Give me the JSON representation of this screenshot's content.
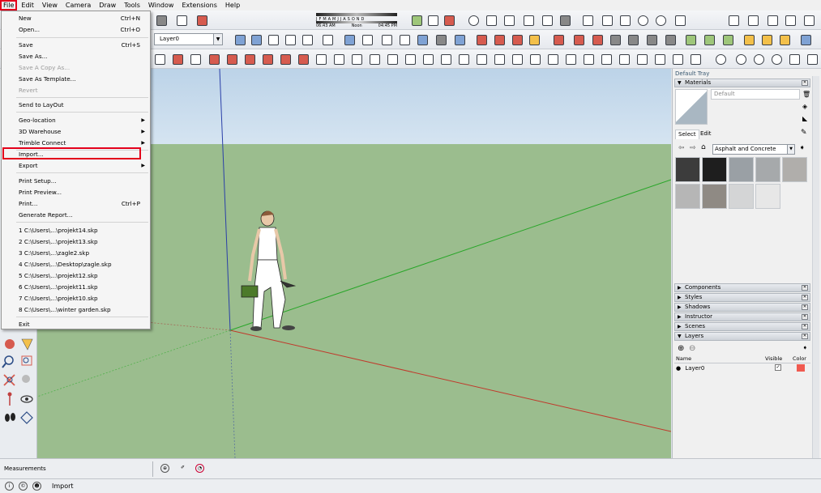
{
  "menubar": {
    "items": [
      "File",
      "Edit",
      "View",
      "Camera",
      "Draw",
      "Tools",
      "Window",
      "Extensions",
      "Help"
    ],
    "active": "File"
  },
  "shadows": {
    "months": "J F M A M J J A S O N D",
    "time_start": "06:43 AM",
    "time_mid": "Noon",
    "time_end": "04:45 PM"
  },
  "layer_select": {
    "value": "Layer0"
  },
  "file_menu": {
    "items": [
      {
        "label": "New",
        "shortcut": "Ctrl+N"
      },
      {
        "label": "Open...",
        "shortcut": "Ctrl+O"
      },
      {
        "label": "Save",
        "shortcut": "Ctrl+S"
      },
      {
        "label": "Save As...",
        "shortcut": ""
      },
      {
        "label": "Save A Copy As...",
        "shortcut": ""
      },
      {
        "label": "Save As Template...",
        "shortcut": ""
      },
      {
        "label": "Revert",
        "shortcut": ""
      },
      {
        "label": "Send to LayOut",
        "shortcut": ""
      },
      {
        "label": "Geo-location",
        "shortcut": ""
      },
      {
        "label": "3D Warehouse",
        "shortcut": ""
      },
      {
        "label": "Trimble Connect",
        "shortcut": ""
      },
      {
        "label": "Import...",
        "shortcut": ""
      },
      {
        "label": "Export",
        "shortcut": ""
      },
      {
        "label": "Print Setup...",
        "shortcut": ""
      },
      {
        "label": "Print Preview...",
        "shortcut": ""
      },
      {
        "label": "Print...",
        "shortcut": "Ctrl+P"
      },
      {
        "label": "Generate Report...",
        "shortcut": ""
      },
      {
        "label": "1 C:\\Users\\...\\projekt14.skp",
        "shortcut": ""
      },
      {
        "label": "2 C:\\Users\\...\\projekt13.skp",
        "shortcut": ""
      },
      {
        "label": "3 C:\\Users\\...\\zagle2.skp",
        "shortcut": ""
      },
      {
        "label": "4 C:\\Users\\...\\Desktop\\zagle.skp",
        "shortcut": ""
      },
      {
        "label": "5 C:\\Users\\...\\projekt12.skp",
        "shortcut": ""
      },
      {
        "label": "6 C:\\Users\\...\\projekt11.skp",
        "shortcut": ""
      },
      {
        "label": "7 C:\\Users\\...\\projekt10.skp",
        "shortcut": ""
      },
      {
        "label": "8 C:\\Users\\...\\winter garden.skp",
        "shortcut": ""
      },
      {
        "label": "Exit",
        "shortcut": ""
      }
    ]
  },
  "tray": {
    "title": "Default Tray",
    "materials": {
      "title": "Materials",
      "name_value": "Default",
      "tab_select": "Select",
      "tab_edit": "Edit",
      "category": "Asphalt and Concrete",
      "swatch_colors": [
        "#3c3c3c",
        "#1e1e1e",
        "#9aa0a5",
        "#a6a9ab",
        "#b0aeab",
        "#b6b6b6",
        "#8f8a84",
        "#d4d5d6",
        "#e7e7e7"
      ]
    },
    "panels": [
      "Components",
      "Styles",
      "Shadows",
      "Instructor",
      "Scenes"
    ],
    "layers": {
      "title": "Layers",
      "col_name": "Name",
      "col_visible": "Visible",
      "col_color": "Color",
      "rows": [
        {
          "name": "Layer0",
          "color": "#f05a50"
        }
      ]
    }
  },
  "measurements": {
    "label": "Measurements"
  },
  "status": {
    "text": "Import"
  },
  "colors": {
    "highlight": "#e3001b",
    "ground": "#9bbd8e",
    "sky": "#c8dcee"
  }
}
